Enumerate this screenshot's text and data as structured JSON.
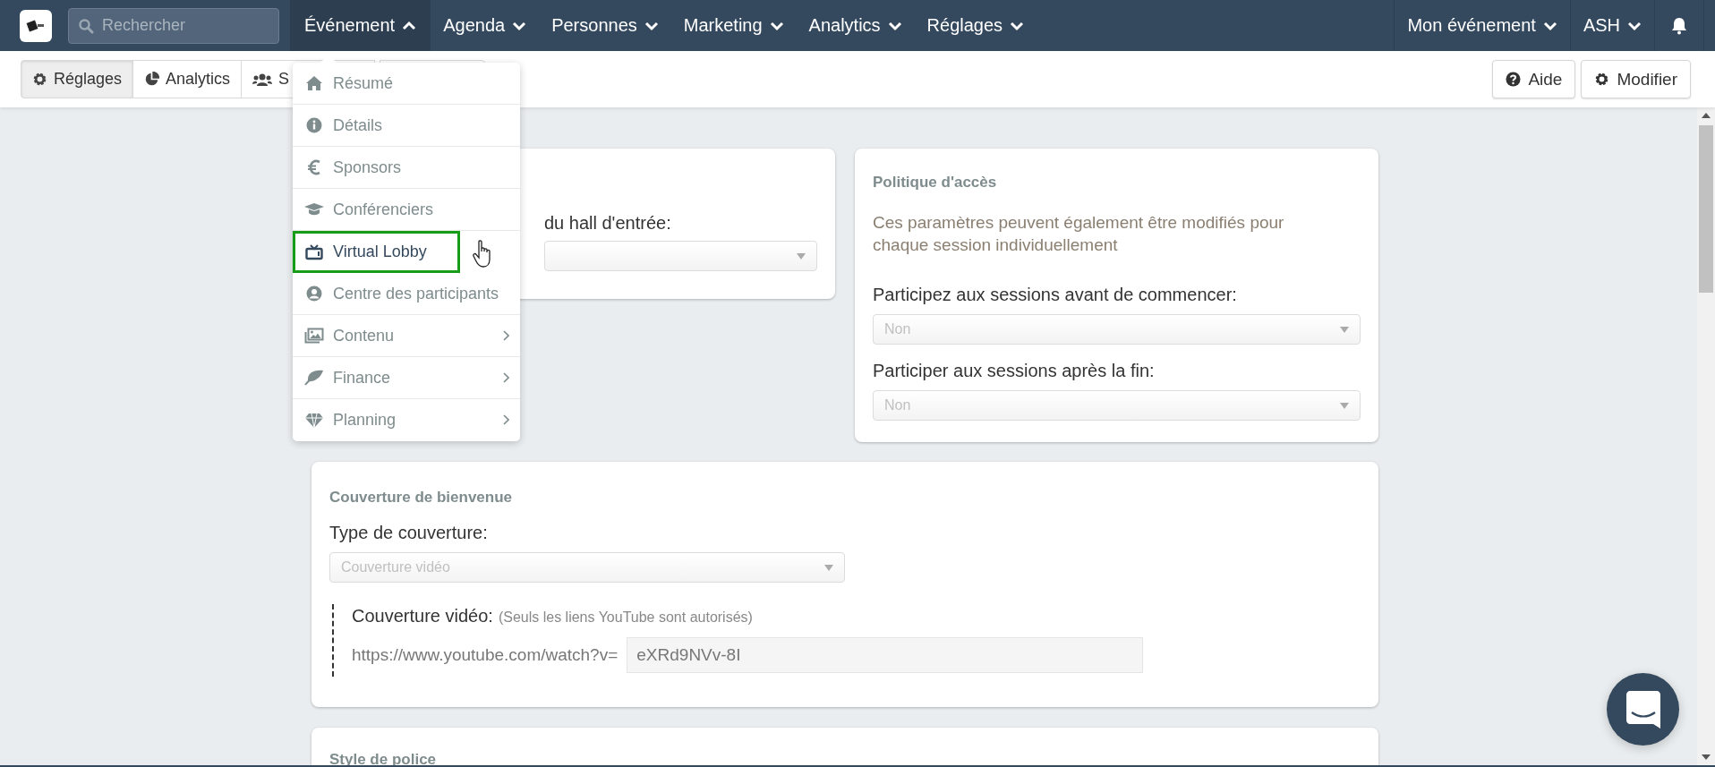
{
  "search": {
    "placeholder": "Rechercher"
  },
  "nav_items": [
    {
      "label": "Événement",
      "expanded": true
    },
    {
      "label": "Agenda",
      "expanded": false
    },
    {
      "label": "Personnes",
      "expanded": false
    },
    {
      "label": "Marketing",
      "expanded": false
    },
    {
      "label": "Analytics",
      "expanded": false
    },
    {
      "label": "Réglages",
      "expanded": false
    }
  ],
  "nav_right": [
    {
      "label": "Mon événement"
    },
    {
      "label": "ASH"
    }
  ],
  "toolbar": [
    {
      "label": "Réglages",
      "selected": true
    },
    {
      "label": "Analytics",
      "selected": false
    },
    {
      "label": "S",
      "selected": false
    }
  ],
  "actions": [
    {
      "label": "Aide"
    },
    {
      "label": "Modifier"
    }
  ],
  "menu": [
    {
      "label": "Résumé",
      "highlighted": false,
      "submenu": false
    },
    {
      "label": "Détails",
      "highlighted": false,
      "submenu": false
    },
    {
      "label": "Sponsors",
      "highlighted": false,
      "submenu": false
    },
    {
      "label": "Conférenciers",
      "highlighted": false,
      "submenu": false
    },
    {
      "label": "Virtual Lobby",
      "highlighted": true,
      "submenu": false
    },
    {
      "label": "Centre des participants",
      "highlighted": false,
      "submenu": false
    },
    {
      "label": "Contenu",
      "highlighted": false,
      "submenu": true
    },
    {
      "label": "Finance",
      "highlighted": false,
      "submenu": true
    },
    {
      "label": "Planning",
      "highlighted": false,
      "submenu": true
    }
  ],
  "lobby_card": {
    "label": "du hall d'entrée:"
  },
  "access_card": {
    "title": "Politique d'accès",
    "description": "Ces paramètres peuvent également être modifiés pour chaque session individuellement",
    "fields": [
      {
        "label": "Participez aux sessions avant de commencer:",
        "value": "Non"
      },
      {
        "label": "Participer aux sessions après la fin:",
        "value": "Non"
      }
    ]
  },
  "cover_card": {
    "title": "Couverture de bienvenue",
    "type_label": "Type de couverture:",
    "type_value": "Couverture vidéo",
    "video_label": "Couverture vidéo:",
    "video_hint": "(Seuls les liens YouTube sont autorisés)",
    "url_prefix": "https://www.youtube.com/watch?v=",
    "video_id": "eXRd9NVv-8I"
  },
  "font_card": {
    "title": "Style de police"
  }
}
